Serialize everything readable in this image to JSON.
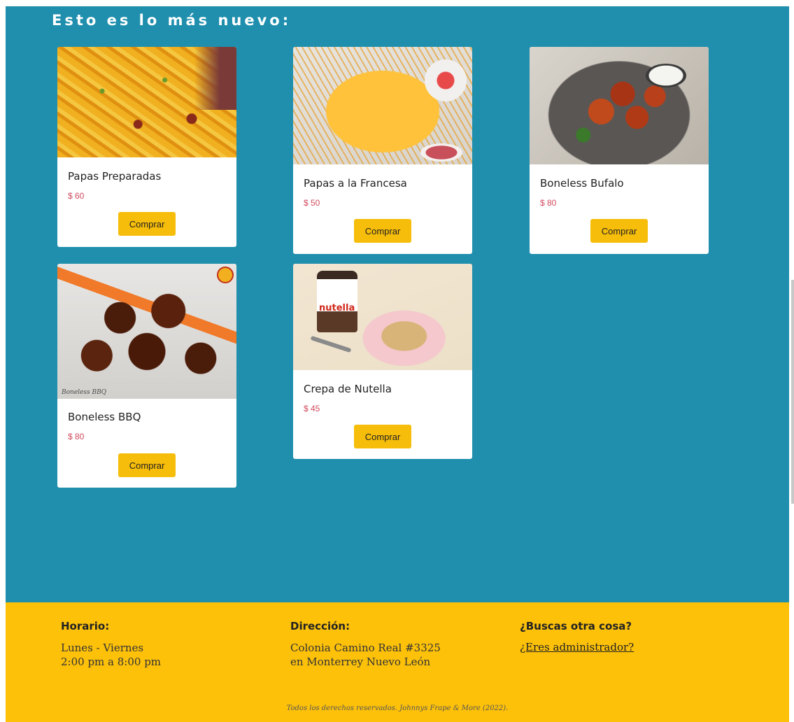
{
  "section": {
    "title": "Esto es lo más nuevo:"
  },
  "products": [
    {
      "name": "Papas Preparadas",
      "price": "$ 60",
      "button": "Comprar",
      "image_icon": "loaded-fries-photo"
    },
    {
      "name": "Papas a la Francesa",
      "price": "$ 50",
      "button": "Comprar",
      "image_icon": "french-fries-photo"
    },
    {
      "name": "Boneless Bufalo",
      "price": "$ 80",
      "button": "Comprar",
      "image_icon": "buffalo-boneless-photo"
    },
    {
      "name": "Boneless BBQ",
      "price": "$ 80",
      "button": "Comprar",
      "image_icon": "bbq-boneless-photo",
      "image_caption": "Boneless BBQ"
    },
    {
      "name": "Crepa de Nutella",
      "price": "$ 45",
      "button": "Comprar",
      "image_icon": "nutella-crepe-photo",
      "image_label": "nutella"
    }
  ],
  "footer": {
    "schedule": {
      "heading": "Horario:",
      "line1": "Lunes - Viernes",
      "line2": "2:00 pm a 8:00 pm"
    },
    "address": {
      "heading": "Dirección:",
      "line1": "Colonia Camino Real #3325",
      "line2": "en Monterrey Nuevo León"
    },
    "other": {
      "heading": "¿Buscas otra cosa?",
      "link": "¿Eres administrador?"
    },
    "copyright": "Todos los derechos reservados. Johnnys Frape & More (2022)."
  },
  "colors": {
    "main_bg": "#1f8fad",
    "footer_bg": "#fdc10a",
    "button_bg": "#f6bd0a",
    "price": "#d04a5e"
  }
}
